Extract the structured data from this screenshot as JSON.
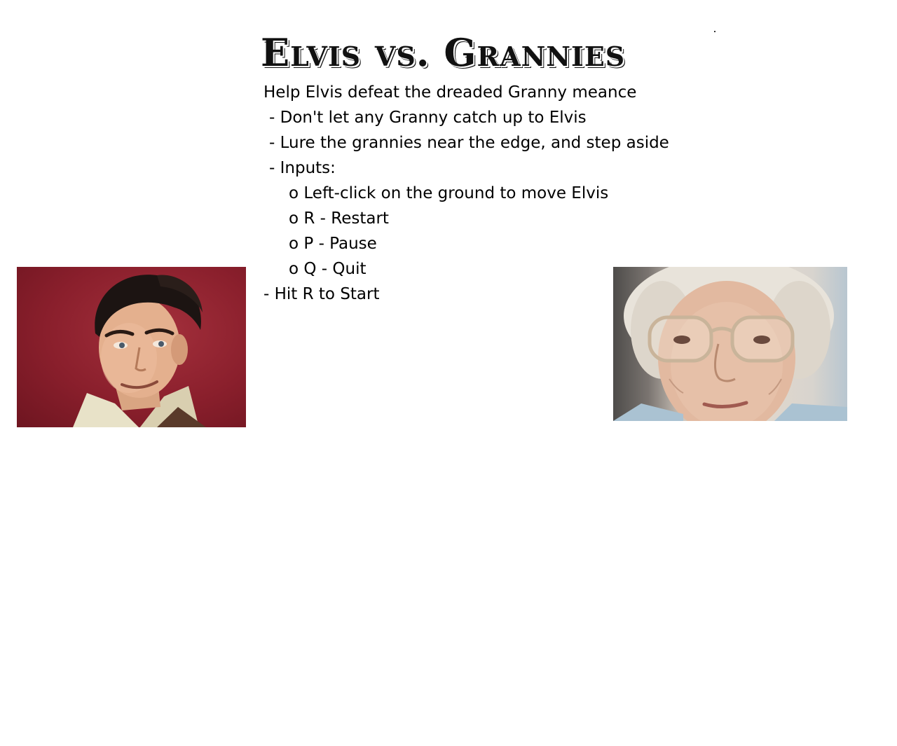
{
  "title": "Elvis vs. Grannies",
  "instructions": {
    "intro": "Help Elvis defeat the dreaded Granny meance",
    "rule_1": "- Don't let any Granny catch up to Elvis",
    "rule_2": "- Lure the grannies near the edge, and step aside",
    "inputs_header": "- Inputs:",
    "input_move": "o Left-click on the ground to move Elvis",
    "input_restart": "o R - Restart",
    "input_pause": "o P - Pause",
    "input_quit": "o Q - Quit",
    "start_hint": "- Hit R to Start"
  },
  "images": {
    "player": "elvis-portrait",
    "enemy": "granny-portrait"
  },
  "colors": {
    "background": "#ffffff",
    "text": "#000000",
    "elvis_backdrop": "#8a1f2c"
  }
}
